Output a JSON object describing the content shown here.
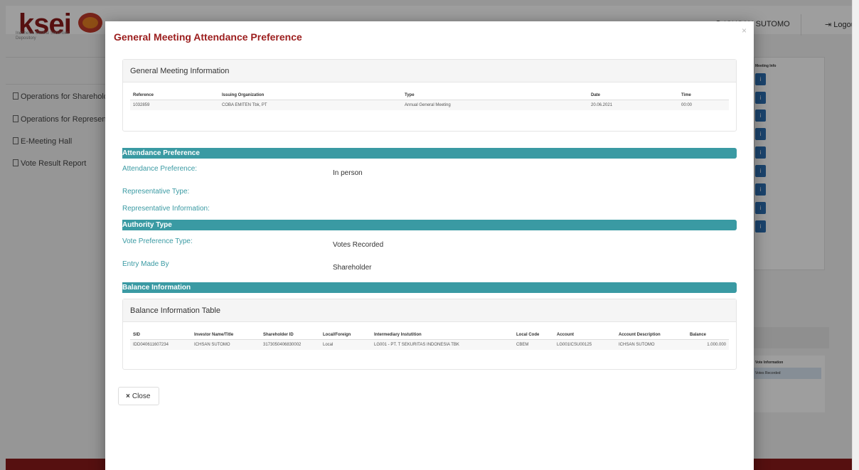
{
  "background": {
    "logo_text": "ksei",
    "logo_subtitle": "Indonesia Central Securities Depository",
    "user_name": "ICHSAN SUTOMO",
    "logout_label": "Logout",
    "sidebar": [
      {
        "label": "Operations for Shareholder"
      },
      {
        "label": "Operations for Representative"
      },
      {
        "label": "E-Meeting Hall"
      },
      {
        "label": "Vote Result Report"
      }
    ],
    "right_panel_title": "Meeting Info",
    "info_button_label": "i",
    "right_panel2_title": "Vote Information",
    "right_panel2_value": "Votes Recorded"
  },
  "modal": {
    "title": "General Meeting Attendance Preference",
    "close_icon": "×",
    "general_meeting": {
      "heading": "General Meeting Information",
      "columns": [
        "Reference",
        "Issuing Organization",
        "Type",
        "Date",
        "Time"
      ],
      "row": [
        "1032859",
        "COBA EMITEN Tbk, PT",
        "Annual General Meeting",
        "20.06.2021",
        "00:00"
      ]
    },
    "attendance": {
      "section_title": "Attendance Preference",
      "attendance_label": "Attendance Preference:",
      "attendance_value": "In person",
      "rep_type_label": "Representative Type:",
      "rep_info_label": "Representative Information:"
    },
    "authority": {
      "section_title": "Authority Type",
      "vote_pref_label": "Vote Preference Type:",
      "vote_pref_value": "Votes Recorded",
      "entry_label": "Entry Made By",
      "entry_value": "Shareholder"
    },
    "balance": {
      "section_title": "Balance Information",
      "table_heading": "Balance Information Table",
      "columns": [
        "SID",
        "Investor Name/Title",
        "Shareholder ID",
        "Local/Foreign",
        "Intermediary Instutition",
        "Local Code",
        "Account",
        "Account Description",
        "Balance"
      ],
      "row": [
        "IDD040611607234",
        "ICHSAN SUTOMO",
        "3173050406830002",
        "Local",
        "LG001 - PT. T SEKURITAS INDONESIA TBK",
        "CBEM",
        "LG001ICSU00125",
        "ICHSAN SUTOMO",
        "1.000.000"
      ]
    },
    "close_button": "Close",
    "close_button_icon": "×"
  }
}
